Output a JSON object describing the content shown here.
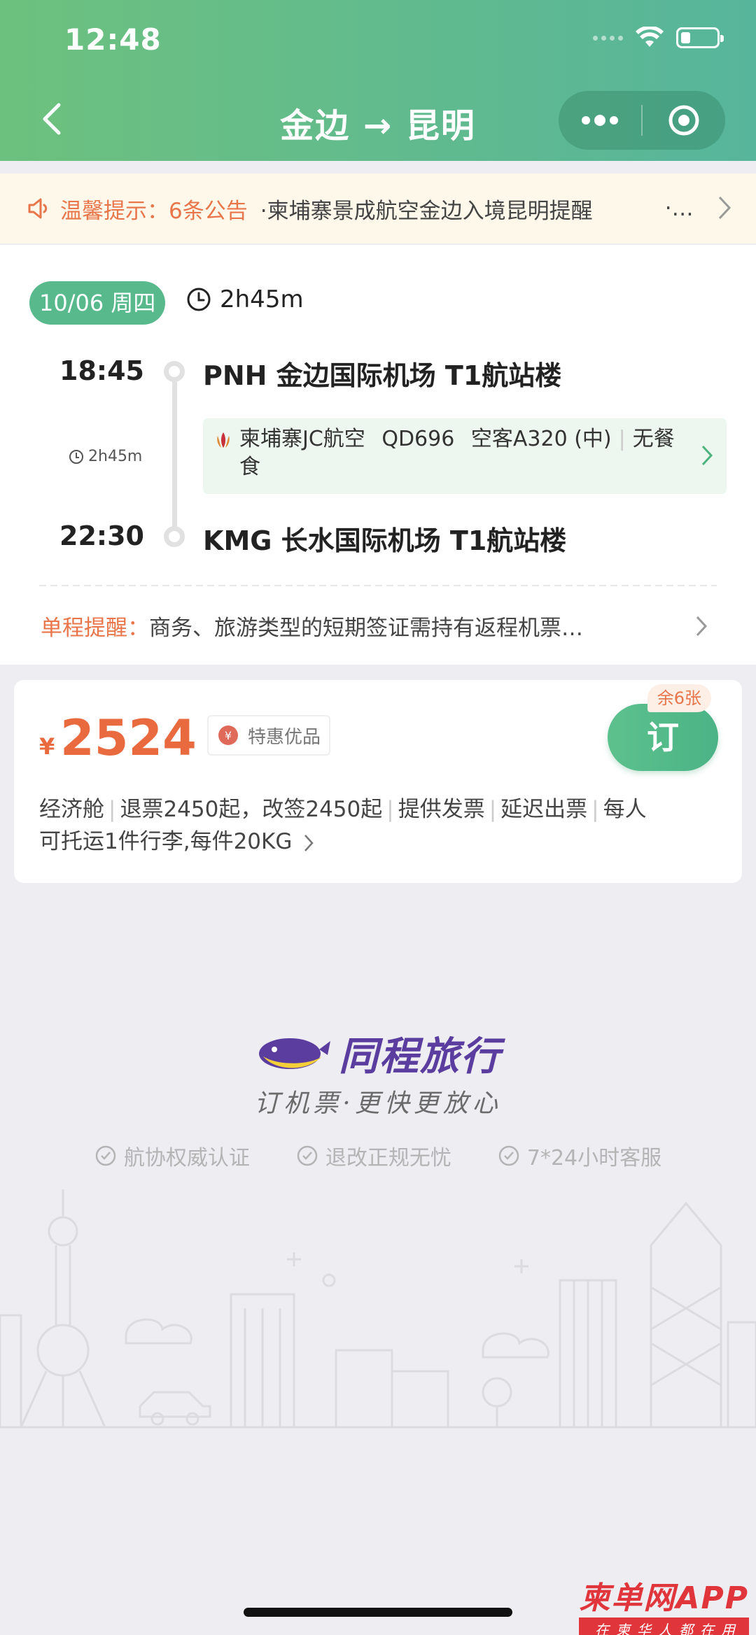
{
  "status_bar": {
    "time": "12:48"
  },
  "nav": {
    "title": "金边 → 昆明"
  },
  "notice": {
    "label": "温馨提示：",
    "count": "6条公告",
    "text": "·柬埔寨景成航空金边入境昆明提醒",
    "more": "·…"
  },
  "flight": {
    "date": "10/06 周四",
    "duration": "2h45m",
    "depart": {
      "time": "18:45",
      "airport": "PNH 金边国际机场 T1航站楼"
    },
    "arrive": {
      "time": "22:30",
      "airport": "KMG 长水国际机场 T1航站楼"
    },
    "mid_duration": "2h45m",
    "airline": "柬埔寨JC航空",
    "flight_no": "QD696",
    "aircraft": "空客A320 (中)",
    "meal_line1": "无餐",
    "meal_line2": "食",
    "reminder_label": "单程提醒：",
    "reminder_text": "商务、旅游类型的短期签证需持有返程机票…"
  },
  "offer": {
    "currency": "¥",
    "price": "2524",
    "tag": "特惠优品",
    "remaining": "余6张",
    "book_label": "订",
    "policy": [
      "经济舱",
      "退票2450起，改签2450起",
      "提供发票",
      "延迟出票",
      "每人"
    ],
    "policy_line2": "可托运1件行李,每件20KG"
  },
  "brand": {
    "name": "同程旅行",
    "slogan": "订机票·更快更放心",
    "guarantees": [
      "航协权威认证",
      "退改正规无忧",
      "7*24小时客服"
    ]
  },
  "watermark": {
    "main": "柬单网APP",
    "sub": "在柬华人都在用"
  },
  "colors": {
    "header_green": "#5cba8c",
    "accent_orange": "#e96a3e",
    "brand_purple": "#5a3d9f"
  }
}
